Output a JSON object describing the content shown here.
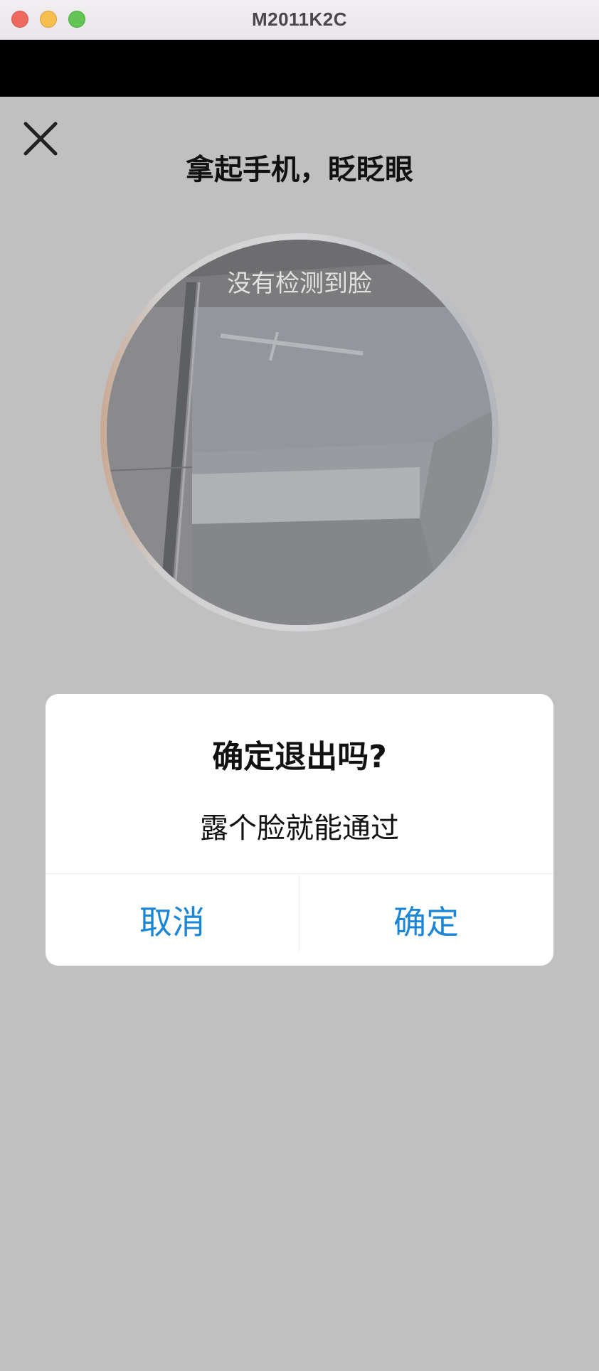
{
  "window": {
    "title": "M2011K2C"
  },
  "page": {
    "prompt_title": "拿起手机，眨眨眼",
    "close_icon": "close-icon"
  },
  "camera": {
    "status_text": "没有检测到脸"
  },
  "dialog": {
    "title": "确定退出吗?",
    "message": "露个脸就能通过",
    "cancel_label": "取消",
    "confirm_label": "确定",
    "button_color": "#1b86d6"
  },
  "colors": {
    "background": "#c0c0c0",
    "status_bar": "#000000",
    "traffic_close": "#ee6a5f",
    "traffic_minimize": "#f5be4f",
    "traffic_zoom": "#62c554"
  }
}
